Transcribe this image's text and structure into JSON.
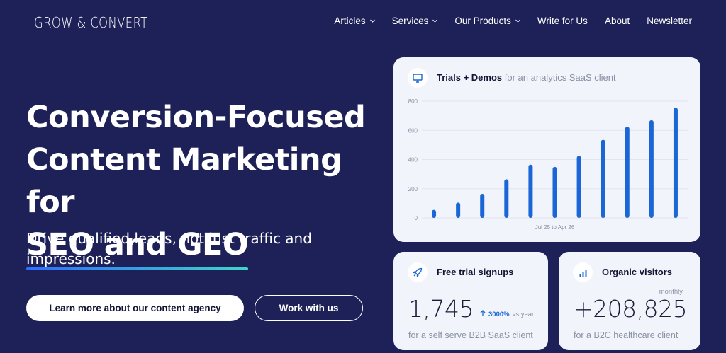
{
  "header": {
    "logo": "GROW & CONVERT",
    "nav": [
      {
        "label": "Articles",
        "has_dropdown": true
      },
      {
        "label": "Services",
        "has_dropdown": true
      },
      {
        "label": "Our Products",
        "has_dropdown": true
      },
      {
        "label": "Write for Us",
        "has_dropdown": false
      },
      {
        "label": "About",
        "has_dropdown": false
      },
      {
        "label": "Newsletter",
        "has_dropdown": false
      }
    ]
  },
  "hero": {
    "title_line1": "Conversion-Focused",
    "title_line2": "Content Marketing for",
    "title_highlight": "SEO and GEO",
    "subtitle": "Drive qualified leads, not just traffic and impressions.",
    "primary_cta": "Learn more about our content agency",
    "secondary_cta": "Work with us"
  },
  "chart_card": {
    "title": "Trials + Demos",
    "subtitle": "for an analytics SaaS client",
    "icon": "monitor-icon"
  },
  "chart_data": {
    "type": "bar",
    "title": "Trials + Demos",
    "xlabel": "Jul 25 to Apr 26",
    "ylabel": "",
    "ylim": [
      0,
      800
    ],
    "yticks": [
      0,
      200,
      400,
      600,
      800
    ],
    "values": [
      55,
      105,
      165,
      265,
      365,
      350,
      425,
      535,
      625,
      670,
      755
    ],
    "grid": true,
    "bar_color": "#1a66d6"
  },
  "signups_card": {
    "title": "Free trial signups",
    "icon": "rocket-icon",
    "value": "1,745",
    "growth_pct": "3000%",
    "growth_suffix": "vs year",
    "footer": "for a self serve B2B SaaS client"
  },
  "visitors_card": {
    "title": "Organic visitors",
    "icon": "bar-chart-icon",
    "period": "monthly",
    "value": "+208,825",
    "footer": "for a B2C healthcare client"
  },
  "colors": {
    "background": "#1e2157",
    "accent": "#1a66d6",
    "card": "#f1f4fb"
  }
}
